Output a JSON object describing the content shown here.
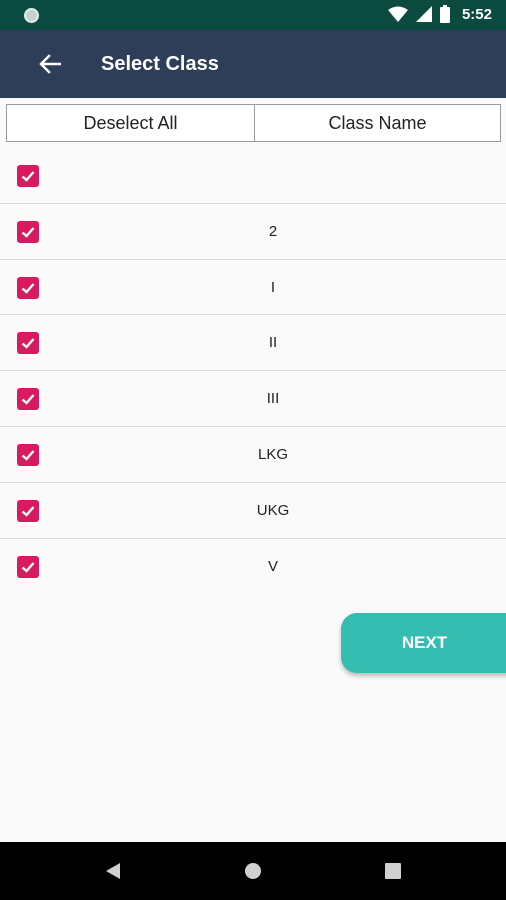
{
  "status_bar": {
    "time": "5:52",
    "icons": [
      "circle-notification-icon",
      "wifi-icon",
      "signal-icon",
      "battery-icon"
    ]
  },
  "app_bar": {
    "back_icon": "arrow-left-icon",
    "title": "Select Class"
  },
  "table_header": {
    "deselect_all_label": "Deselect All",
    "class_name_label": "Class Name"
  },
  "classes": [
    {
      "name": "",
      "checked": true
    },
    {
      "name": "2",
      "checked": true
    },
    {
      "name": "I",
      "checked": true
    },
    {
      "name": "II",
      "checked": true
    },
    {
      "name": "III",
      "checked": true
    },
    {
      "name": "LKG",
      "checked": true
    },
    {
      "name": "UKG",
      "checked": true
    },
    {
      "name": "V",
      "checked": true
    }
  ],
  "next_button": {
    "label": "NEXT"
  },
  "colors": {
    "status_bar": "#0b4a3f",
    "app_bar": "#2e3e59",
    "checkbox": "#d81b60",
    "next_button": "#35bdb2"
  },
  "nav_bar": {
    "icons": [
      "back-triangle-icon",
      "home-circle-icon",
      "recents-square-icon"
    ]
  }
}
